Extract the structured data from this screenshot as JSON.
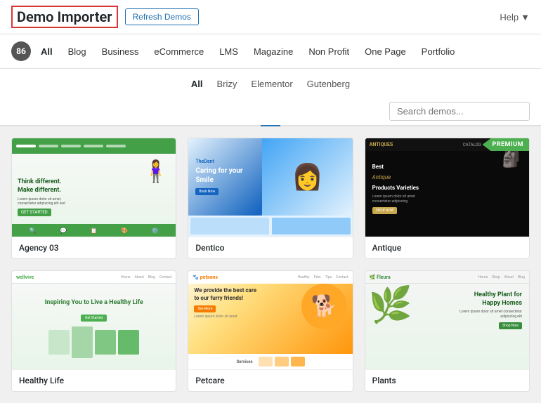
{
  "header": {
    "title": "Demo Importer",
    "refresh_label": "Refresh Demos",
    "help_label": "Help",
    "help_arrow": "▼"
  },
  "category_bar": {
    "count": "86",
    "categories": [
      {
        "id": "all",
        "label": "All",
        "active": true
      },
      {
        "id": "blog",
        "label": "Blog",
        "active": false
      },
      {
        "id": "business",
        "label": "Business",
        "active": false
      },
      {
        "id": "ecommerce",
        "label": "eCommerce",
        "active": false
      },
      {
        "id": "lms",
        "label": "LMS",
        "active": false
      },
      {
        "id": "magazine",
        "label": "Magazine",
        "active": false
      },
      {
        "id": "nonprofit",
        "label": "Non Profit",
        "active": false
      },
      {
        "id": "onepage",
        "label": "One Page",
        "active": false
      },
      {
        "id": "portfolio",
        "label": "Portfolio",
        "active": false
      }
    ]
  },
  "sub_filter": {
    "tabs": [
      {
        "id": "all",
        "label": "All",
        "active": true
      },
      {
        "id": "brizy",
        "label": "Brizy",
        "active": false
      },
      {
        "id": "elementor",
        "label": "Elementor",
        "active": false
      },
      {
        "id": "gutenberg",
        "label": "Gutenberg",
        "active": false
      }
    ],
    "search_placeholder": "Search demos..."
  },
  "demos": [
    {
      "id": "agency03",
      "name": "Agency 03",
      "premium": false,
      "type": "agency",
      "hero_text": "Think different.\nMake different.",
      "cta": "GET STARTED"
    },
    {
      "id": "dentico",
      "name": "Dentico",
      "premium": false,
      "type": "dentico",
      "hero_text": "Caring for your Smile"
    },
    {
      "id": "antique",
      "name": "Antique",
      "premium": true,
      "type": "antique",
      "hero_line1": "Best",
      "hero_line2": "Antique",
      "hero_line3": "Products Varieties",
      "cta": "SHOP NOW"
    },
    {
      "id": "healthy",
      "name": "Healthy Life",
      "premium": false,
      "type": "healthy",
      "headline": "Inspiring You to Live a Healthy Life"
    },
    {
      "id": "petcare",
      "name": "Petcare",
      "premium": false,
      "type": "petcare",
      "line1": "We provide the best care\nto our furry friends!",
      "cta": "See More",
      "sub": "Services"
    },
    {
      "id": "plants",
      "name": "Plants",
      "premium": false,
      "type": "plants",
      "headline": "Healthy Plant for\nHappy Homes",
      "cta": "Shop Now"
    }
  ]
}
